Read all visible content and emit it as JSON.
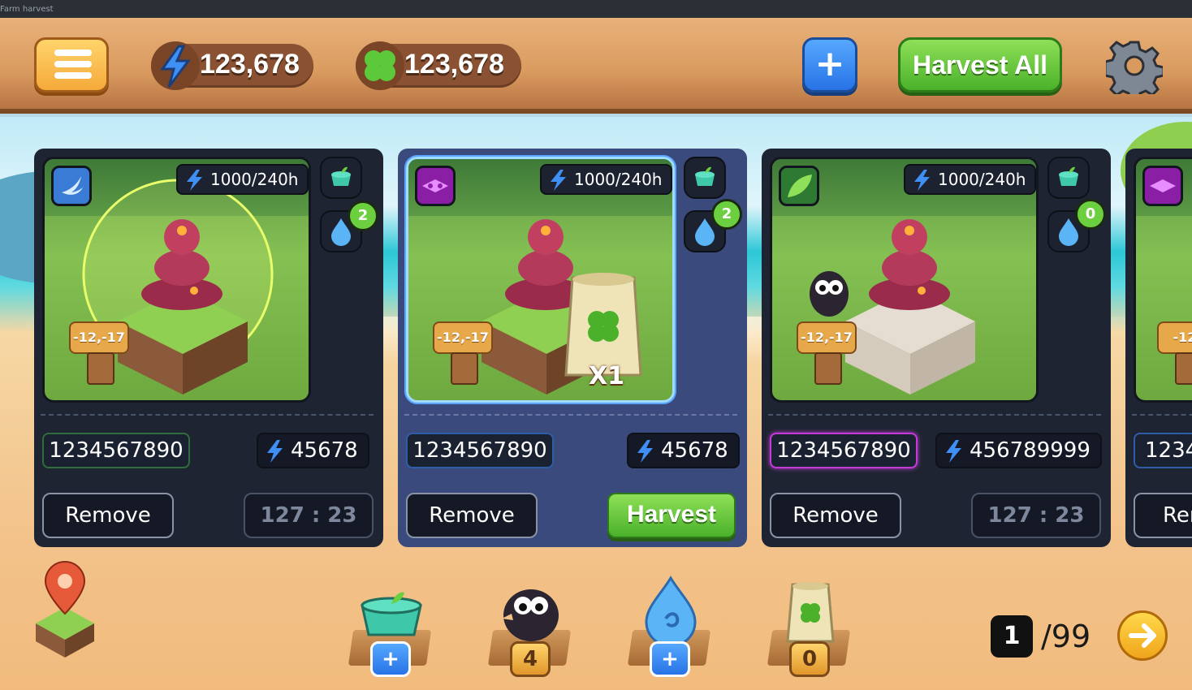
{
  "window": {
    "title": "Farm harvest"
  },
  "topbar": {
    "energy": "123,678",
    "clover": "123,678",
    "harvest_all_label": "Harvest All"
  },
  "cards": [
    {
      "rate": "1000/240h",
      "coords": "-12,-17",
      "water_badge": "2",
      "id": "1234567890",
      "points": "45678",
      "remove_label": "Remove",
      "timer": "127 : 23"
    },
    {
      "rate": "1000/240h",
      "coords": "-12,-17",
      "water_badge": "2",
      "id": "1234567890",
      "points": "45678",
      "remove_label": "Remove",
      "harvest_label": "Harvest",
      "seed_multiplier": "X1"
    },
    {
      "rate": "1000/240h",
      "coords": "-12,-17",
      "water_badge": "0",
      "id": "1234567890",
      "points": "456789999",
      "remove_label": "Remove",
      "timer": "127 : 23"
    },
    {
      "id_partial": "1234",
      "remove_partial": "Rem",
      "coords_partial": "-12,"
    }
  ],
  "toolbar": {
    "pot_tag": "+",
    "crow_tag": "4",
    "water_tag": "+",
    "seed_tag": "0"
  },
  "pagination": {
    "current": "1",
    "total": "/99"
  },
  "colors": {
    "accent_green": "#4bb12a",
    "accent_blue": "#2773e6",
    "card_bg": "#1e2432",
    "card_selected_bg": "#3b4a7c",
    "rare_purple": "#8a1fa6"
  }
}
